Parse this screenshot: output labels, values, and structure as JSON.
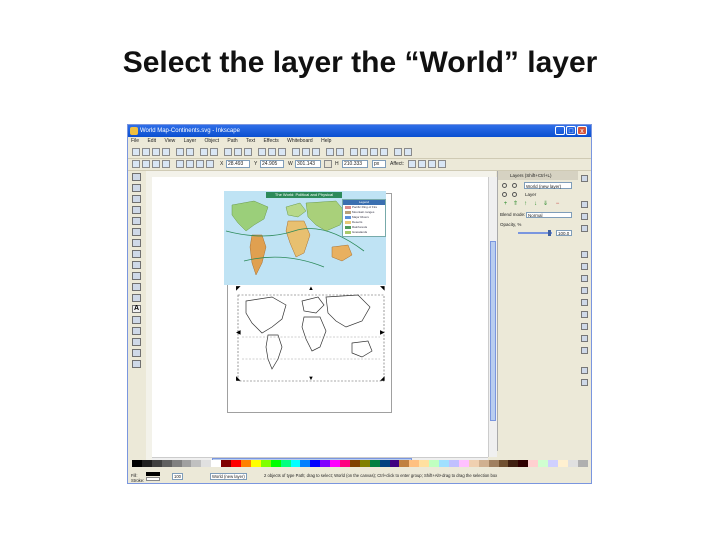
{
  "slide": {
    "title": "Select the layer the “World” layer"
  },
  "window": {
    "title": "World Map-Continents.svg - Inkscape",
    "min": "_",
    "max": "□",
    "close": "x"
  },
  "menu": [
    "File",
    "Edit",
    "View",
    "Layer",
    "Object",
    "Path",
    "Text",
    "Effects",
    "Whiteboard",
    "Help"
  ],
  "toolbar2": {
    "x": "X",
    "x_value": "28.493",
    "y": "Y",
    "y_value": "24.905",
    "w": "W",
    "w_value": "301.143",
    "h": "H",
    "h_value": "210.333",
    "units": "px",
    "affect": "Affect:"
  },
  "map": {
    "heading": "The World: Political and Physical"
  },
  "legend": {
    "title": "Legend",
    "items": [
      {
        "label": "Pacific Ring of Fire",
        "color": "#d98c8c"
      },
      {
        "label": "Mountain ranges",
        "color": "#b9a17a"
      },
      {
        "label": "Major Rivers",
        "color": "#5a8fd8"
      },
      {
        "label": "Deserts",
        "color": "#e8c978"
      },
      {
        "label": "Rainforests",
        "color": "#4f9a5a"
      },
      {
        "label": "Grasslands",
        "color": "#a9c96a"
      }
    ]
  },
  "layers_panel": {
    "header": "Layers (Shift+Ctrl+L)",
    "rows": [
      {
        "name": "World (new layer)"
      },
      {
        "name": "Layer"
      }
    ],
    "blend_label": "Blend mode:",
    "blend_value": "Normal",
    "opacity_label": "Opacity, %",
    "opacity_value": "100.0"
  },
  "palette": [
    "#000000",
    "#202020",
    "#404040",
    "#606060",
    "#808080",
    "#a0a0a0",
    "#c0c0c0",
    "#e0e0e0",
    "#ffffff",
    "#800000",
    "#ff0000",
    "#ff8000",
    "#ffff00",
    "#80ff00",
    "#00ff00",
    "#00ff80",
    "#00ffff",
    "#0080ff",
    "#0000ff",
    "#8000ff",
    "#ff00ff",
    "#ff0080",
    "#804000",
    "#808000",
    "#008040",
    "#004080",
    "#400080",
    "#c08040",
    "#ffc080",
    "#ffe0a0",
    "#c0ffc0",
    "#a0e0ff",
    "#c0c0ff",
    "#ffc0ff",
    "#f0d0b0",
    "#d0b090",
    "#a08060",
    "#705030",
    "#402010",
    "#300000",
    "#ffd0d0",
    "#d0ffd0",
    "#d0d0ff",
    "#fff0d0",
    "#e0e0e0",
    "#b0b0b0"
  ],
  "status": {
    "fill_label": "Fill:",
    "stroke_label": "Stroke:",
    "opacity": "100",
    "layer_field": "World (new layer)",
    "message": "2 objects of type Path; drag to select; World (on the canvas); Ctrl+click to enter group; Shift+Alt+drag to drag the selection box"
  }
}
